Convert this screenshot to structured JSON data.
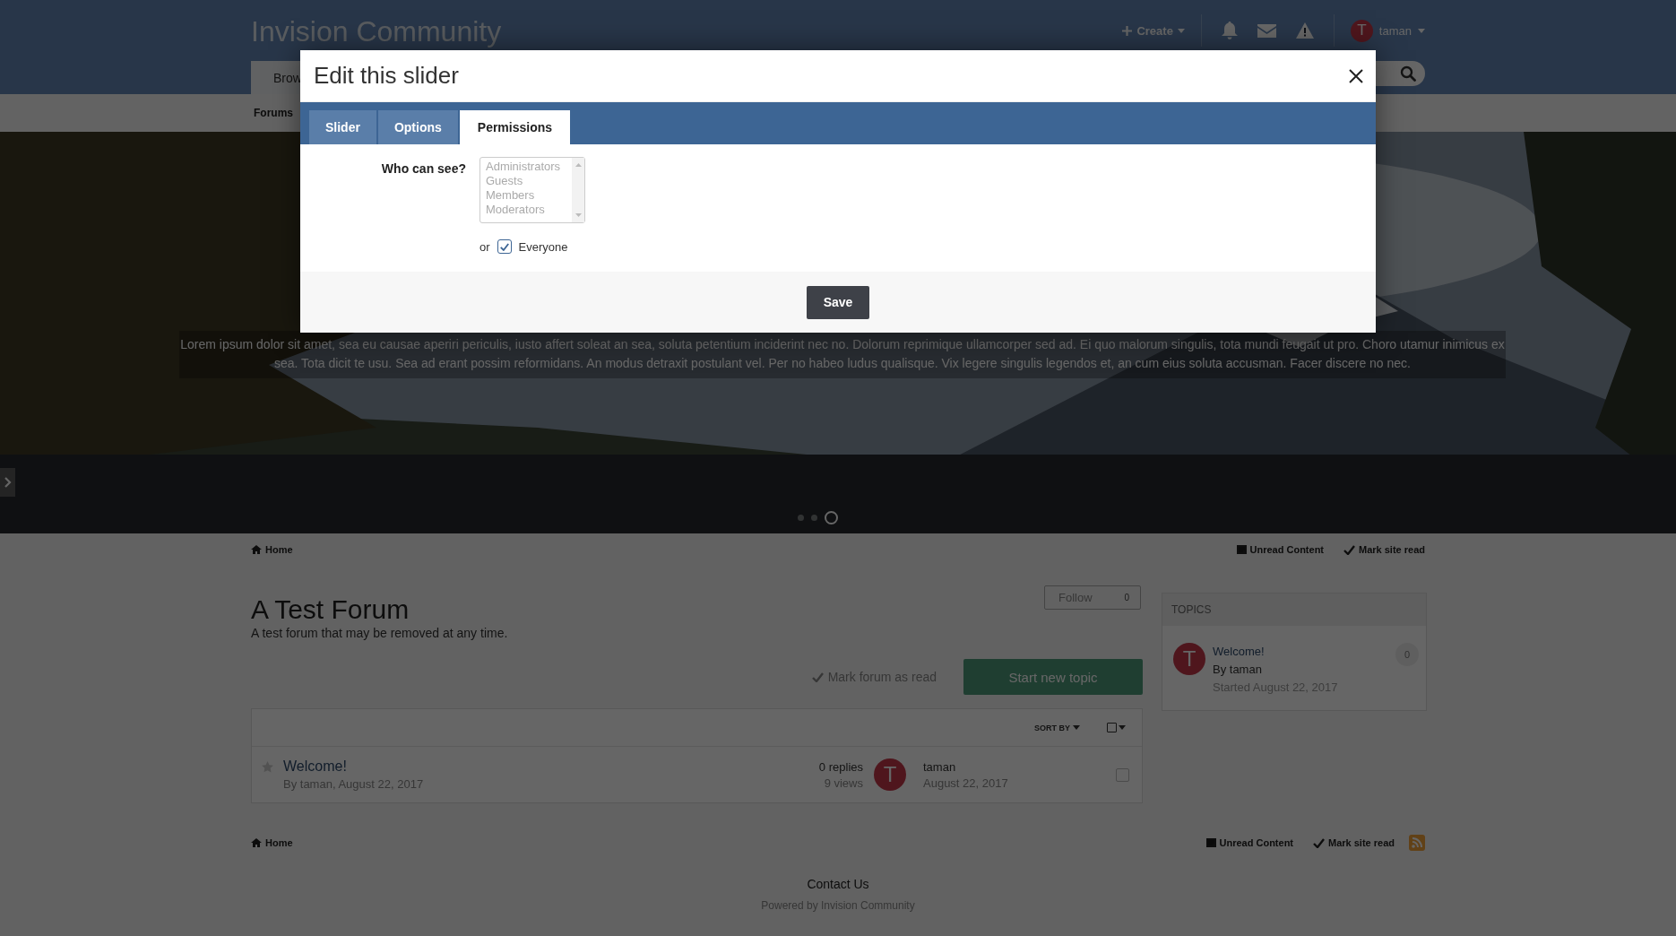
{
  "header": {
    "site_title": "Invision Community",
    "create": "Create",
    "avatar_letter": "T",
    "username": "taman"
  },
  "nav": {
    "tabs": [
      {
        "label": "Brow",
        "selected": true
      }
    ],
    "sub_items": [
      "Forums"
    ]
  },
  "slider": {
    "caption": "Lorem ipsum dolor sit amet, sea eu causae aperiri periculis, iusto affert soleat an sea, soluta petentium inciderint nec no. Dolorum reprimique ullamcorper sed ad. Ei quo malorum singulis, tota mundi feugait ut pro. Choro utamur inimicus ex sea. Tota dicit te usu. Sea ad erant possim reformidans. An modus detraxit postulant vel. Per no habeo ludus qualisque. Vix legere singulis legendos et, an cum eius soluta accusman. Facer discere no nec.",
    "dots": [
      {
        "selected": false
      },
      {
        "selected": false
      },
      {
        "selected": true
      }
    ]
  },
  "breadcrumb": {
    "home": "Home",
    "links": [
      "Unread Content",
      "Mark site read"
    ]
  },
  "forum": {
    "title": "A Test Forum",
    "description": "A test forum that may be removed at any time.",
    "follow": {
      "label": "Follow",
      "count": "0"
    },
    "mark_read": "Mark forum as read",
    "start_topic": "Start new topic",
    "sort_by": "SORT BY",
    "topics": [
      {
        "title": "Welcome!",
        "meta": "By taman, August 22, 2017",
        "replies": "0 replies",
        "views": "9 views",
        "avatar_letter": "T",
        "last_poster": "taman",
        "last_date": "August 22, 2017",
        "checked": false
      }
    ]
  },
  "sidebar": {
    "heading": "TOPICS",
    "items": [
      {
        "avatar_letter": "T",
        "title": "Welcome!",
        "author": "By taman",
        "started": "Started August 22, 2017",
        "count": "0"
      }
    ]
  },
  "footer_breadcrumb": {
    "home": "Home",
    "links": [
      "Unread Content",
      "Mark site read"
    ]
  },
  "footer": {
    "contact": "Contact Us",
    "powered": "Powered by Invision Community"
  },
  "modal": {
    "title": "Edit this slider",
    "tabs": [
      {
        "label": "Slider",
        "selected": false
      },
      {
        "label": "Options",
        "selected": false
      },
      {
        "label": "Permissions",
        "selected": true
      }
    ],
    "permission_label": "Who can see?",
    "permission_select": {
      "disabled": true,
      "options": [
        "Administrators",
        "Guests",
        "Members",
        "Moderators"
      ]
    },
    "or": "or",
    "everyone": {
      "label": "Everyone",
      "checked": true
    },
    "save": "Save"
  }
}
